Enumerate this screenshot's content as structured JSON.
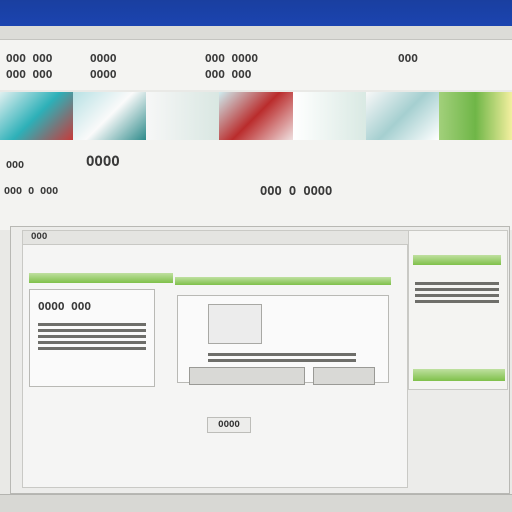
{
  "header": {
    "row1_left": "OOO OOO",
    "row1_mid": "OOOO",
    "row1_right": "OOO OOOO",
    "row1_far": "OOO",
    "row2_left": "OOO OOO",
    "row2_mid": "OOOO",
    "row2_right": "OOO OOO"
  },
  "mid": {
    "t1": "OOO",
    "t2": "OOOO",
    "t3": "OOO O OOO",
    "t4": "OOO O OOOO"
  },
  "main": {
    "title": "OOO",
    "center_button": "OOOO",
    "left_panel_text": "OOOO OOO"
  },
  "colors": {
    "accent_blue": "#1b44b0",
    "accent_green": "#7fc04a"
  }
}
